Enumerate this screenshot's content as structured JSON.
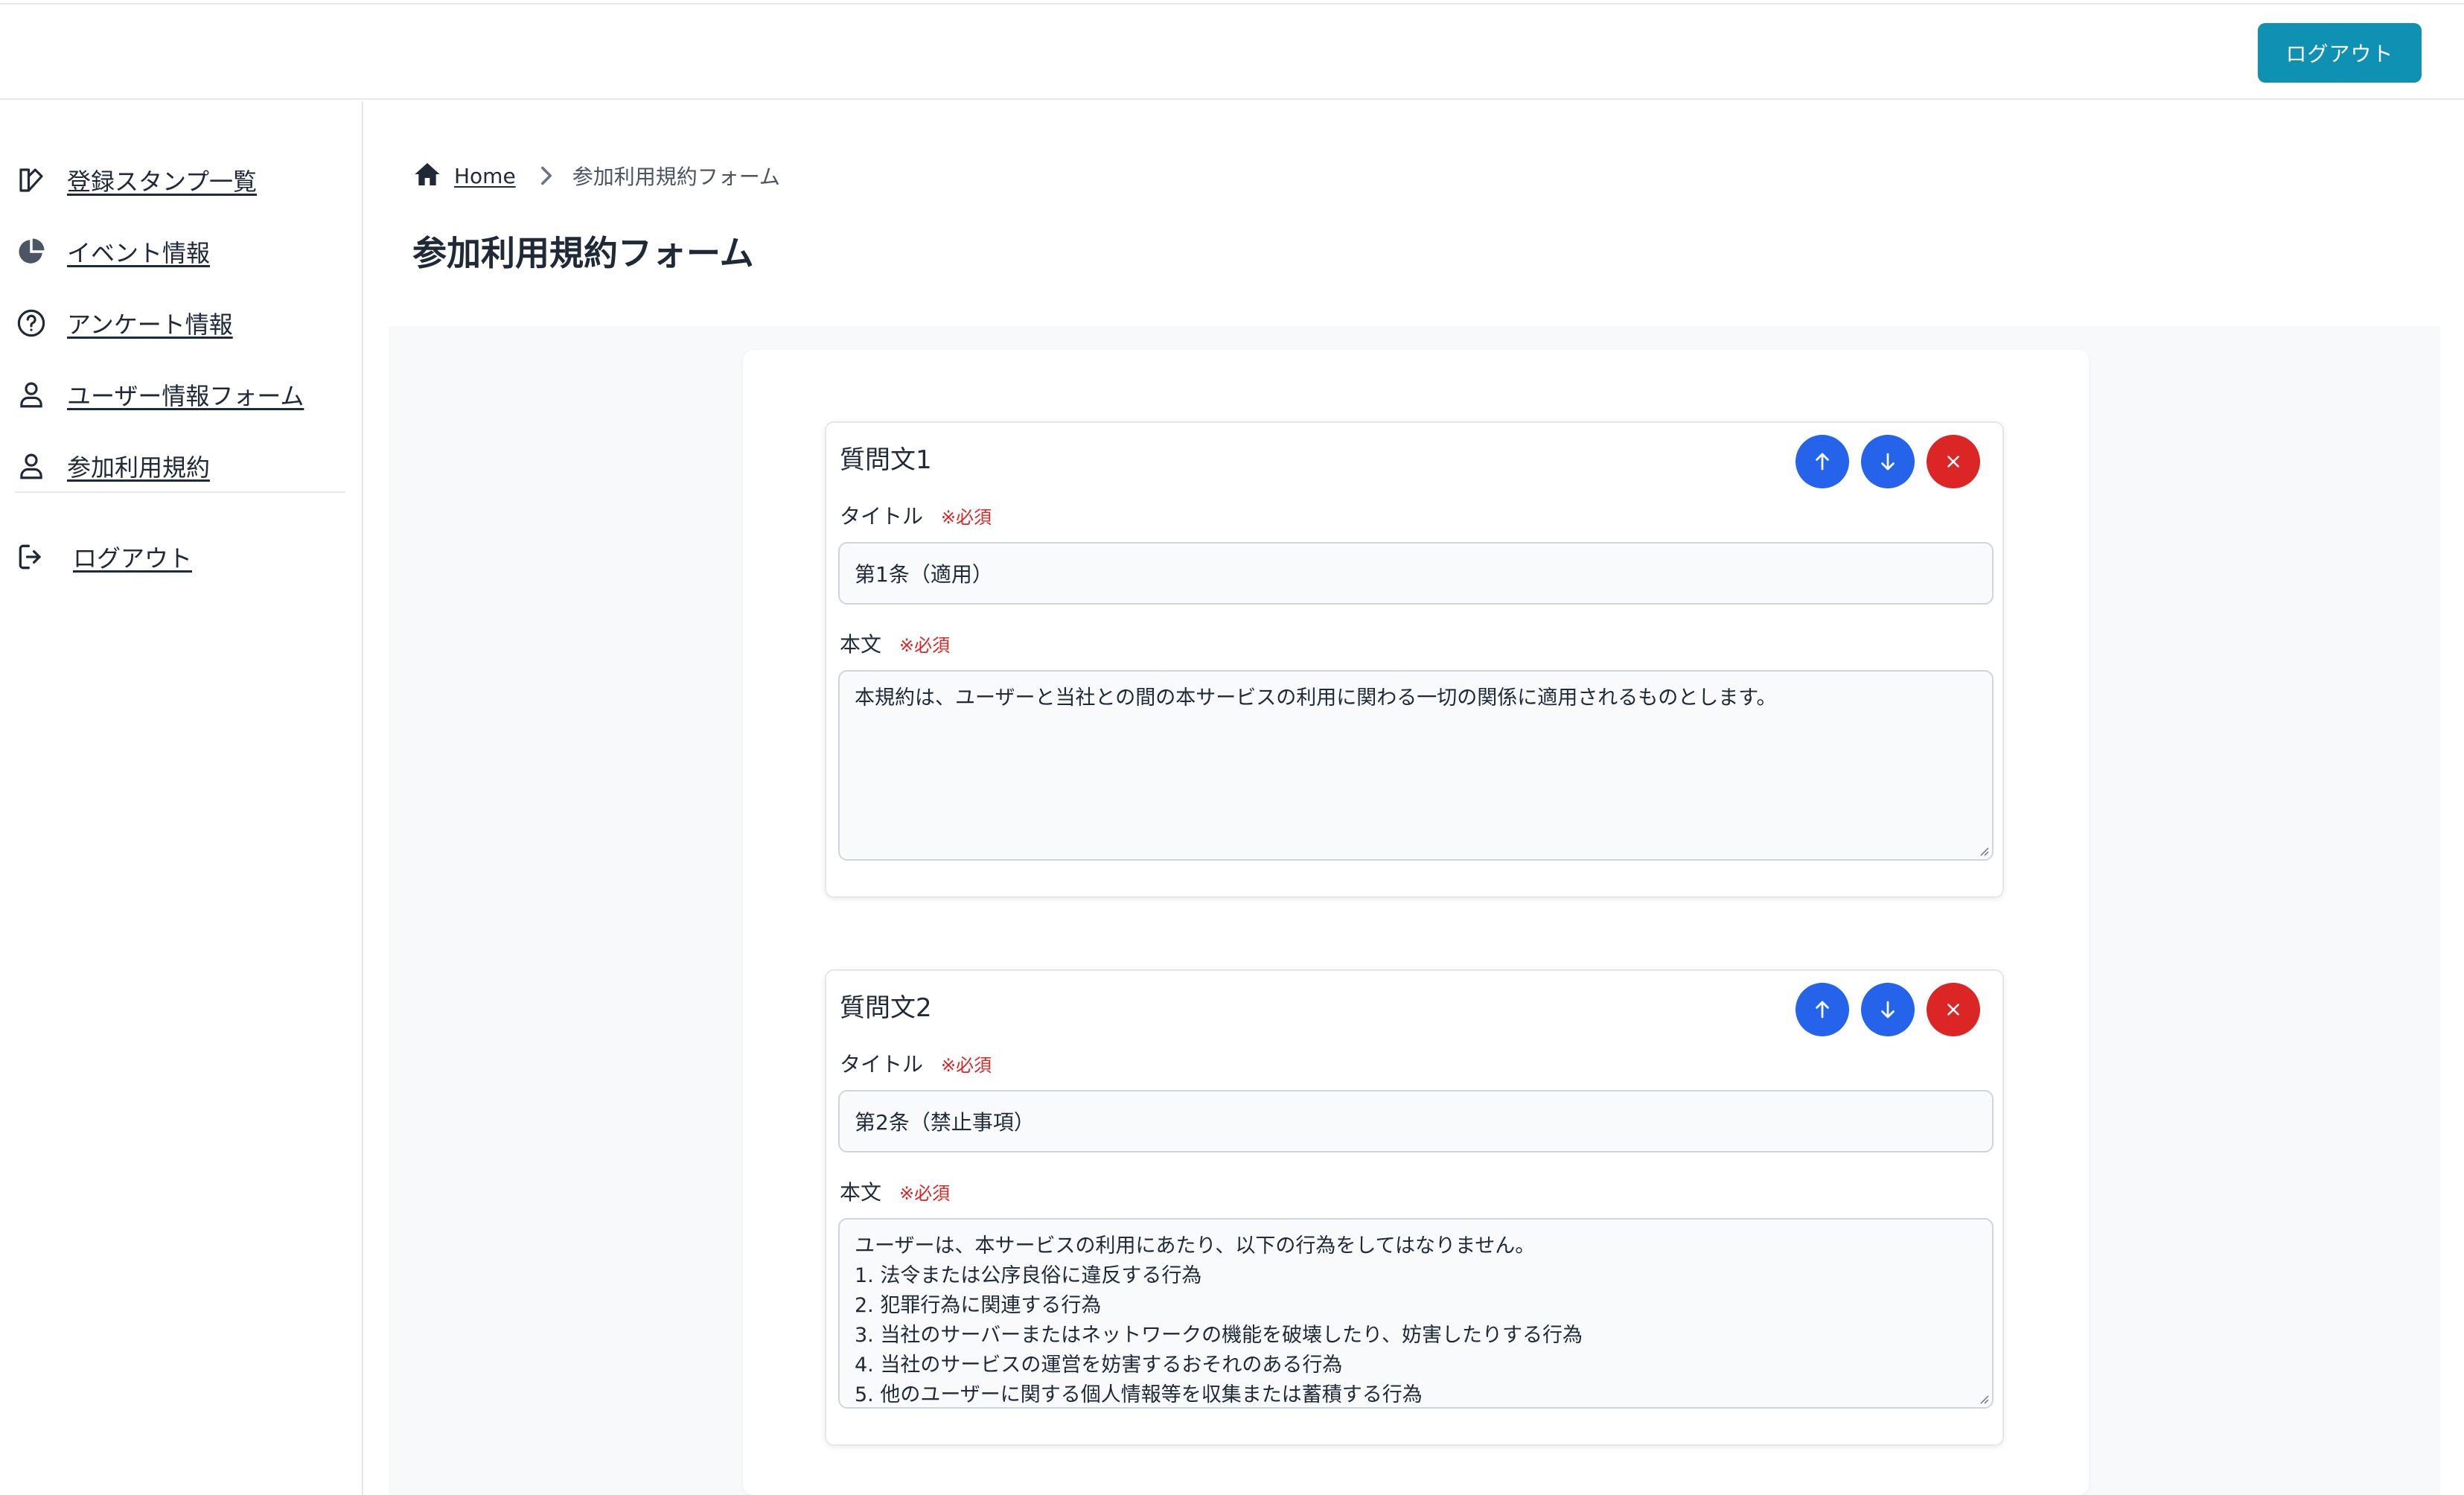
{
  "header": {
    "logout_label": "ログアウト"
  },
  "sidebar": {
    "items": [
      {
        "label": "登録スタンプ一覧",
        "icon": "stamp-icon"
      },
      {
        "label": "イベント情報",
        "icon": "pie-chart-icon"
      },
      {
        "label": "アンケート情報",
        "icon": "question-circle-icon"
      },
      {
        "label": "ユーザー情報フォーム",
        "icon": "user-icon"
      },
      {
        "label": "参加利用規約",
        "icon": "user-icon"
      }
    ],
    "logout": {
      "label": "ログアウト",
      "icon": "logout-icon"
    }
  },
  "breadcrumb": {
    "home": "Home",
    "current": "参加利用規約フォーム"
  },
  "page": {
    "title": "参加利用規約フォーム"
  },
  "questions": [
    {
      "title": "質問文1",
      "title_label": "タイトル",
      "body_label": "本文",
      "required": "※必須",
      "title_value": "第1条（適用）",
      "body_lines": [
        "本規約は、ユーザーと当社との間の本サービスの利用に関わる一切の関係に適用されるものとします。"
      ]
    },
    {
      "title": "質問文2",
      "title_label": "タイトル",
      "body_label": "本文",
      "required": "※必須",
      "title_value": "第2条（禁止事項）",
      "body_lines": [
        "ユーザーは、本サービスの利用にあたり、以下の行為をしてはなりません。",
        "1. 法令または公序良俗に違反する行為",
        "2. 犯罪行為に関連する行為",
        "3. 当社のサーバーまたはネットワークの機能を破壊したり、妨害したりする行為",
        "4. 当社のサービスの運営を妨害するおそれのある行為",
        "5. 他のユーザーに関する個人情報等を収集または蓄積する行為"
      ]
    }
  ],
  "colors": {
    "primary": "#0e91b3",
    "move": "#2563eb",
    "delete": "#dc2626",
    "required": "#dc2626"
  }
}
